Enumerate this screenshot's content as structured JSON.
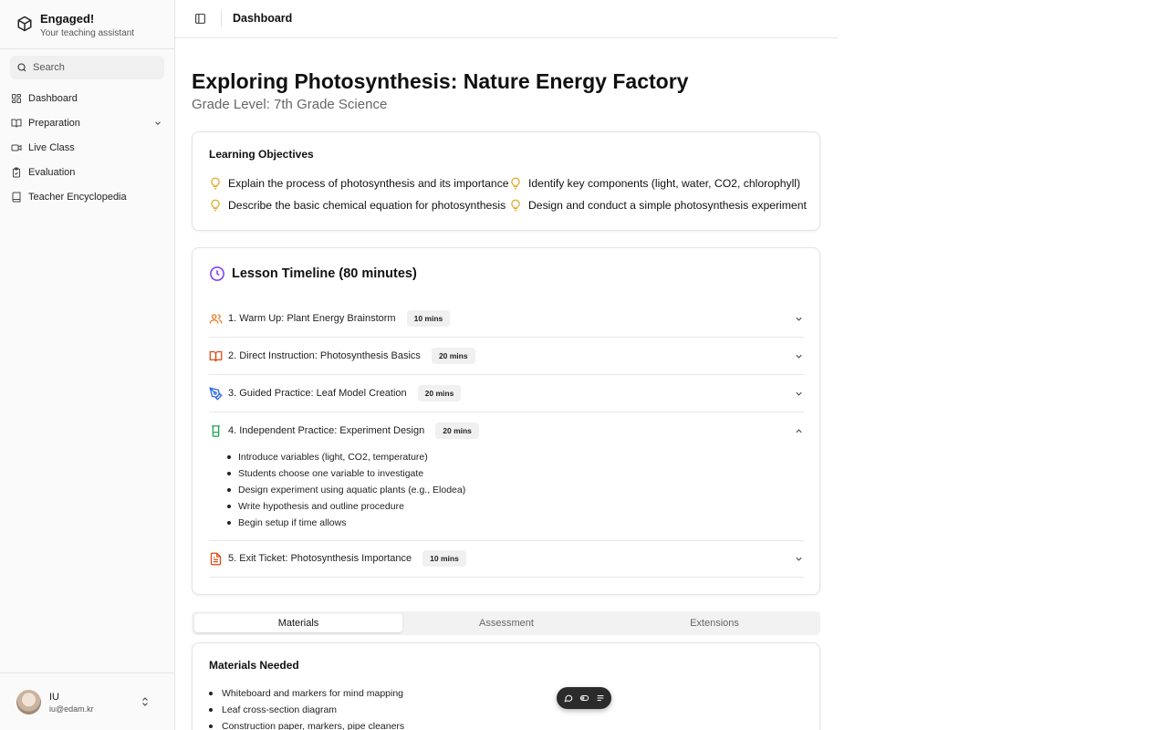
{
  "app": {
    "name": "Engaged!",
    "tagline": "Your teaching assistant"
  },
  "search": {
    "placeholder": "Search"
  },
  "sidebar": {
    "items": [
      {
        "label": "Dashboard",
        "icon": "dashboard-icon"
      },
      {
        "label": "Preparation",
        "icon": "book-open-icon",
        "expandable": true
      },
      {
        "label": "Live Class",
        "icon": "video-icon"
      },
      {
        "label": "Evaluation",
        "icon": "clipboard-check-icon"
      },
      {
        "label": "Teacher Encyclopedia",
        "icon": "book-icon"
      }
    ]
  },
  "user": {
    "name": "IU",
    "email": "iu@edam.kr"
  },
  "header": {
    "title": "Dashboard"
  },
  "lesson": {
    "title": "Exploring Photosynthesis: Nature Energy Factory",
    "grade": "Grade Level: 7th Grade Science"
  },
  "objectives": {
    "title": "Learning Objectives",
    "items": [
      "Explain the process of photosynthesis and its importance",
      "Identify key components (light, water, CO2, chlorophyll)",
      "Describe the basic chemical equation for photosynthesis",
      "Design and conduct a simple photosynthesis experiment"
    ],
    "icon_color": "#e0a31a"
  },
  "timeline": {
    "title": "Lesson Timeline (80 minutes)",
    "icon_color": "#7c3aed",
    "items": [
      {
        "label": "1. Warm Up: Plant Energy Brainstorm",
        "duration": "10 mins",
        "icon": "users-icon",
        "color": "#ea7a1e",
        "expanded": false
      },
      {
        "label": "2. Direct Instruction: Photosynthesis Basics",
        "duration": "20 mins",
        "icon": "book-open-icon",
        "color": "#d9480f",
        "expanded": false
      },
      {
        "label": "3. Guided Practice: Leaf Model Creation",
        "duration": "20 mins",
        "icon": "pen-tool-icon",
        "color": "#2563eb",
        "expanded": false
      },
      {
        "label": "4. Independent Practice: Experiment Design",
        "duration": "20 mins",
        "icon": "beaker-icon",
        "color": "#16a34a",
        "expanded": true,
        "details": [
          "Introduce variables (light, CO2, temperature)",
          "Students choose one variable to investigate",
          "Design experiment using aquatic plants (e.g., Elodea)",
          "Write hypothesis and outline procedure",
          "Begin setup if time allows"
        ]
      },
      {
        "label": "5. Exit Ticket: Photosynthesis Importance",
        "duration": "10 mins",
        "icon": "file-text-icon",
        "color": "#d9480f",
        "expanded": false
      }
    ]
  },
  "tabs": [
    {
      "label": "Materials",
      "active": true
    },
    {
      "label": "Assessment",
      "active": false
    },
    {
      "label": "Extensions",
      "active": false
    }
  ],
  "materials": {
    "title": "Materials Needed",
    "items": [
      "Whiteboard and markers for mind mapping",
      "Leaf cross-section diagram",
      "Construction paper, markers, pipe cleaners"
    ]
  },
  "float_toolbar": {
    "icons": [
      "chat-icon",
      "toggle-icon",
      "list-icon"
    ]
  }
}
